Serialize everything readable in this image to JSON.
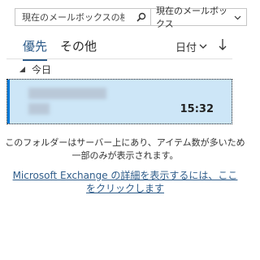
{
  "search": {
    "placeholder": "現在のメールボックスの検索",
    "icon": "search-icon",
    "scope_value": "現在のメールボックス"
  },
  "tabs": [
    {
      "label": "優先",
      "active": true
    },
    {
      "label": "その他",
      "active": false
    }
  ],
  "sort": {
    "label": "日付"
  },
  "group": {
    "label": "今日"
  },
  "message": {
    "time": "15:32",
    "selected": true
  },
  "info_text": "このフォルダーはサーバー上にあり、アイテム数が多いため一部のみが表示されます。",
  "exchange_link": "Microsoft Exchange の詳細を表示するには、ここをクリックします",
  "colors": {
    "accent": "#2e5c8a",
    "selected_bg": "#cde6f7",
    "selected_bar": "#0078d7"
  }
}
